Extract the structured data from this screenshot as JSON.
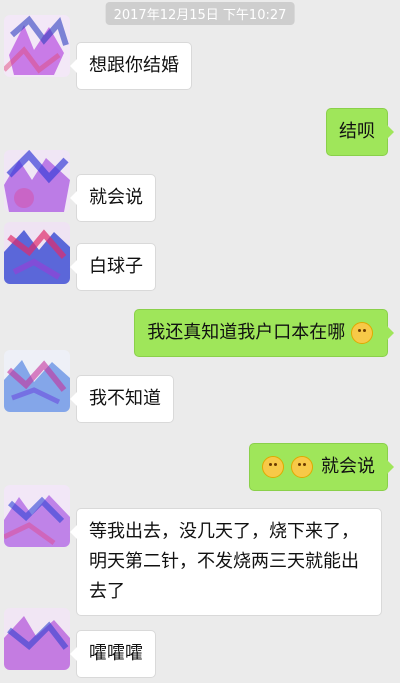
{
  "timestamp": "2017年12月15日 下午10:27",
  "messages": [
    {
      "side": "left",
      "text": "想跟你结婚"
    },
    {
      "side": "right",
      "text": "结呗"
    },
    {
      "side": "left",
      "text": "就会说"
    },
    {
      "side": "left",
      "text": "白球子"
    },
    {
      "side": "right",
      "text": "我还真知道我户口本在哪",
      "emoji_after": "smile-emoji-icon"
    },
    {
      "side": "left",
      "text": "我不知道"
    },
    {
      "side": "right",
      "text": "就会说",
      "emoji_before": "hug-emoji-icon"
    },
    {
      "side": "left",
      "text": "等我出去，没几天了，烧下来了，明天第二针，不发烧两三天就能出去了"
    },
    {
      "side": "left",
      "text": "嚯嚯嚯"
    }
  ],
  "colors": {
    "background": "#ebebeb",
    "my_bubble": "#9fe65a",
    "their_bubble": "#ffffff"
  }
}
